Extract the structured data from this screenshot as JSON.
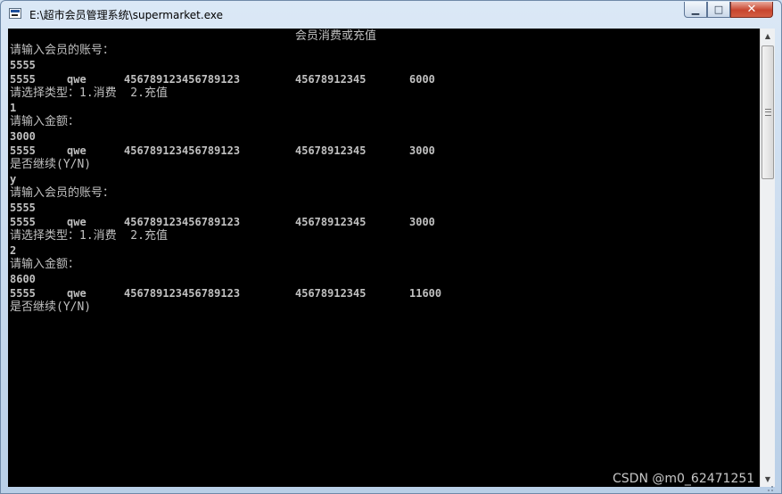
{
  "window": {
    "title": "E:\\超市会员管理系统\\supermarket.exe",
    "minimize_glyph": "▁",
    "maximize_glyph": "□",
    "close_glyph": "✕"
  },
  "console": {
    "header": "会员消费或充值",
    "lines": [
      {
        "type": "text",
        "text": "请输入会员的账号："
      },
      {
        "type": "text",
        "text": "5555",
        "bold": true
      },
      {
        "type": "record",
        "id": "5555",
        "name": "qwe",
        "card": "456789123456789123",
        "phone": "45678912345",
        "balance": "6000"
      },
      {
        "type": "text",
        "text": "请选择类型：1.消费  2.充值"
      },
      {
        "type": "text",
        "text": "1",
        "bold": true
      },
      {
        "type": "text",
        "text": "请输入金额："
      },
      {
        "type": "text",
        "text": "3000",
        "bold": true
      },
      {
        "type": "record",
        "id": "5555",
        "name": "qwe",
        "card": "456789123456789123",
        "phone": "45678912345",
        "balance": "3000"
      },
      {
        "type": "text",
        "text": "是否继续(Y/N)"
      },
      {
        "type": "text",
        "text": "y",
        "bold": true
      },
      {
        "type": "text",
        "text": "请输入会员的账号："
      },
      {
        "type": "text",
        "text": "5555",
        "bold": true
      },
      {
        "type": "record",
        "id": "5555",
        "name": "qwe",
        "card": "456789123456789123",
        "phone": "45678912345",
        "balance": "3000"
      },
      {
        "type": "text",
        "text": "请选择类型：1.消费  2.充值"
      },
      {
        "type": "text",
        "text": "2",
        "bold": true
      },
      {
        "type": "text",
        "text": "请输入金额："
      },
      {
        "type": "text",
        "text": "8600",
        "bold": true
      },
      {
        "type": "record",
        "id": "5555",
        "name": "qwe",
        "card": "456789123456789123",
        "phone": "45678912345",
        "balance": "11600"
      },
      {
        "type": "text",
        "text": "是否继续(Y/N)"
      }
    ]
  },
  "scrollbar": {
    "up_glyph": "▲",
    "down_glyph": "▼"
  },
  "watermark": "CSDN @m0_62471251",
  "colors": {
    "console_bg": "#000000",
    "console_text": "#c0c0c0",
    "close_button": "#c8452f"
  }
}
